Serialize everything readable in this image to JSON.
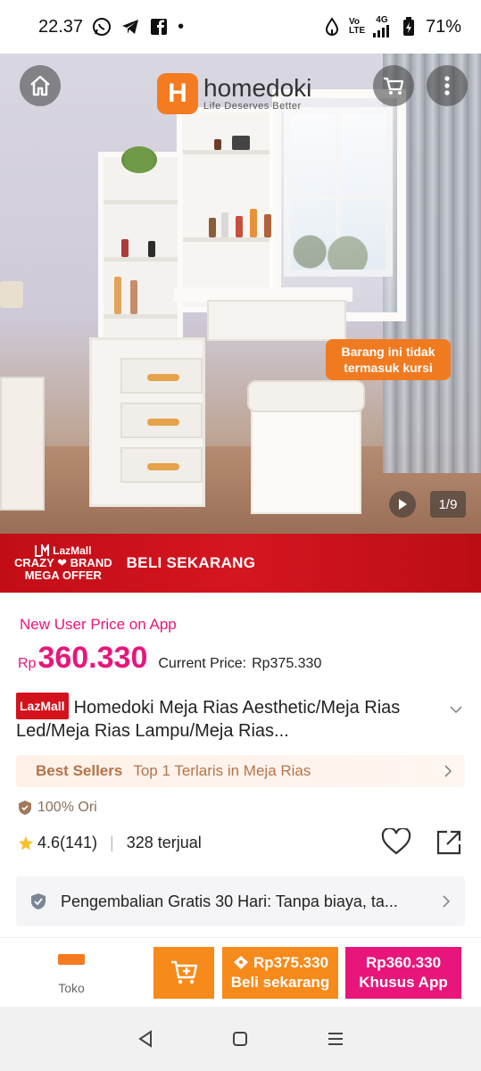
{
  "status_bar": {
    "time": "22.37",
    "volte_label": "Vo LTE",
    "network_label": "4G",
    "battery": "71%",
    "notification_dot": "•"
  },
  "hero": {
    "brand_name": "homedoki",
    "brand_tagline": "Life Deserves Better",
    "brand_initial": "H",
    "stool_note": "Barang ini tidak termasuk kursi",
    "image_counter": "1/9"
  },
  "promo": {
    "lazmall": "LazMall",
    "line1": "CRAZY ❤ BRAND",
    "line2": "MEGA OFFER",
    "cta": "BELI SEKARANG"
  },
  "pricing": {
    "new_user_label": "New User Price on App",
    "currency": "Rp",
    "new_user_price": "360.330",
    "current_label": "Current Price:",
    "current_price": "Rp375.330"
  },
  "product": {
    "mall_badge": "LazMall",
    "title": "Homedoki Meja Rias Aesthetic/Meja Rias Led/Meja Rias Lampu/Meja Rias..."
  },
  "best_sellers": {
    "label": "Best Sellers",
    "text": "Top 1 Terlaris in Meja Rias"
  },
  "authentic": {
    "label": "100% Ori"
  },
  "rating": {
    "score": "4.6(141)",
    "sold": "328 terjual"
  },
  "returns": {
    "text": "Pengembalian Gratis 30 Hari: Tanpa biaya, ta..."
  },
  "bottom_bar": {
    "shop_label": "Toko",
    "buy_price": "Rp375.330",
    "buy_label": "Beli sekarang",
    "app_price": "Rp360.330",
    "app_label": "Khusus App"
  },
  "colors": {
    "accent_pink": "#e8167a",
    "accent_orange": "#f68a1a",
    "promo_red": "#c20d17"
  }
}
